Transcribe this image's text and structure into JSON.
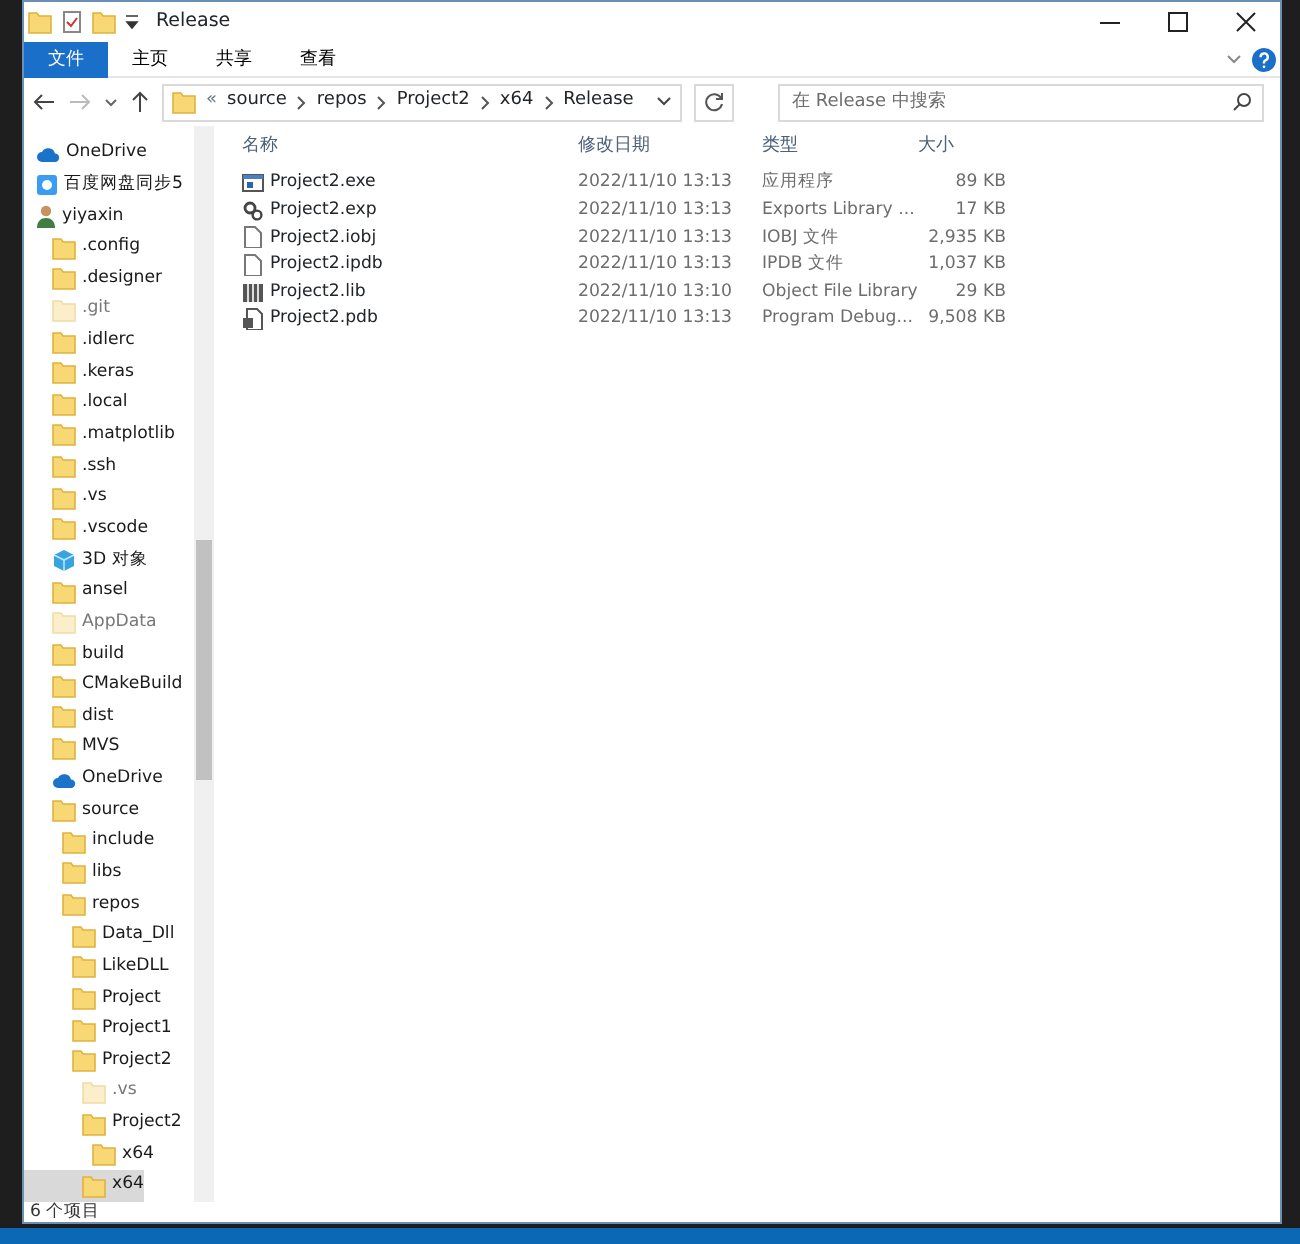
{
  "window": {
    "title": "Release"
  },
  "ribbon_tabs": [
    {
      "label": "文件",
      "selected": true
    },
    {
      "label": "主页",
      "selected": false
    },
    {
      "label": "共享",
      "selected": false
    },
    {
      "label": "查看",
      "selected": false
    }
  ],
  "address": {
    "overflow": "«",
    "crumbs": [
      "source",
      "repos",
      "Project2",
      "x64",
      "Release"
    ]
  },
  "search": {
    "placeholder": "在 Release 中搜索"
  },
  "sidebar": {
    "items": [
      {
        "label": "OneDrive",
        "kind": "cloud",
        "hidden": false,
        "selected": false
      },
      {
        "label": "百度网盘同步5",
        "kind": "drive",
        "hidden": false,
        "selected": false
      },
      {
        "label": "yiyaxin",
        "kind": "user",
        "hidden": false,
        "selected": false,
        "children": [
          {
            "label": ".config",
            "kind": "folder",
            "hidden": false,
            "selected": false
          },
          {
            "label": ".designer",
            "kind": "folder",
            "hidden": false,
            "selected": false
          },
          {
            "label": ".git",
            "kind": "folder",
            "hidden": true,
            "selected": false
          },
          {
            "label": ".idlerc",
            "kind": "folder",
            "hidden": false,
            "selected": false
          },
          {
            "label": ".keras",
            "kind": "folder",
            "hidden": false,
            "selected": false
          },
          {
            "label": ".local",
            "kind": "folder",
            "hidden": false,
            "selected": false
          },
          {
            "label": ".matplotlib",
            "kind": "folder",
            "hidden": false,
            "selected": false
          },
          {
            "label": ".ssh",
            "kind": "folder",
            "hidden": false,
            "selected": false
          },
          {
            "label": ".vs",
            "kind": "folder",
            "hidden": false,
            "selected": false
          },
          {
            "label": ".vscode",
            "kind": "folder",
            "hidden": false,
            "selected": false
          },
          {
            "label": "3D 对象",
            "kind": "objects3d",
            "hidden": false,
            "selected": false
          },
          {
            "label": "ansel",
            "kind": "folder",
            "hidden": false,
            "selected": false
          },
          {
            "label": "AppData",
            "kind": "folder",
            "hidden": true,
            "selected": false
          },
          {
            "label": "build",
            "kind": "folder",
            "hidden": false,
            "selected": false
          },
          {
            "label": "CMakeBuild",
            "kind": "folder",
            "hidden": false,
            "selected": false
          },
          {
            "label": "dist",
            "kind": "folder",
            "hidden": false,
            "selected": false
          },
          {
            "label": "MVS",
            "kind": "folder",
            "hidden": false,
            "selected": false
          },
          {
            "label": "OneDrive",
            "kind": "cloud",
            "hidden": false,
            "selected": false
          },
          {
            "label": "source",
            "kind": "folder",
            "hidden": false,
            "selected": false,
            "children": [
              {
                "label": "include",
                "kind": "folder",
                "hidden": false,
                "selected": false
              },
              {
                "label": "libs",
                "kind": "folder",
                "hidden": false,
                "selected": false
              },
              {
                "label": "repos",
                "kind": "folder",
                "hidden": false,
                "selected": false,
                "children": [
                  {
                    "label": "Data_Dll",
                    "kind": "folder",
                    "hidden": false,
                    "selected": false
                  },
                  {
                    "label": "LikeDLL",
                    "kind": "folder",
                    "hidden": false,
                    "selected": false
                  },
                  {
                    "label": "Project",
                    "kind": "folder",
                    "hidden": false,
                    "selected": false
                  },
                  {
                    "label": "Project1",
                    "kind": "folder",
                    "hidden": false,
                    "selected": false
                  },
                  {
                    "label": "Project2",
                    "kind": "folder",
                    "hidden": false,
                    "selected": false,
                    "children": [
                      {
                        "label": ".vs",
                        "kind": "folder",
                        "hidden": true,
                        "selected": false
                      },
                      {
                        "label": "Project2",
                        "kind": "folder",
                        "hidden": false,
                        "selected": false,
                        "children": [
                          {
                            "label": "x64",
                            "kind": "folder",
                            "hidden": false,
                            "selected": false
                          }
                        ]
                      },
                      {
                        "label": "x64",
                        "kind": "folder",
                        "hidden": false,
                        "selected": true
                      }
                    ]
                  }
                ]
              }
            ]
          }
        ]
      }
    ]
  },
  "table": {
    "columns": [
      "名称",
      "修改日期",
      "类型",
      "大小"
    ],
    "rows": [
      {
        "kind": "exe",
        "name": "Project2.exe",
        "date": "2022/11/10 13:13",
        "type": "应用程序",
        "size": "89 KB"
      },
      {
        "kind": "exp",
        "name": "Project2.exp",
        "date": "2022/11/10 13:13",
        "type": "Exports Library ...",
        "size": "17 KB"
      },
      {
        "kind": "file",
        "name": "Project2.iobj",
        "date": "2022/11/10 13:13",
        "type": "IOBJ 文件",
        "size": "2,935 KB"
      },
      {
        "kind": "file",
        "name": "Project2.ipdb",
        "date": "2022/11/10 13:13",
        "type": "IPDB 文件",
        "size": "1,037 KB"
      },
      {
        "kind": "lib",
        "name": "Project2.lib",
        "date": "2022/11/10 13:10",
        "type": "Object File Library",
        "size": "29 KB"
      },
      {
        "kind": "pdb",
        "name": "Project2.pdb",
        "date": "2022/11/10 13:13",
        "type": "Program Debug...",
        "size": "9,508 KB"
      }
    ]
  },
  "status_bar": "6 个项目"
}
